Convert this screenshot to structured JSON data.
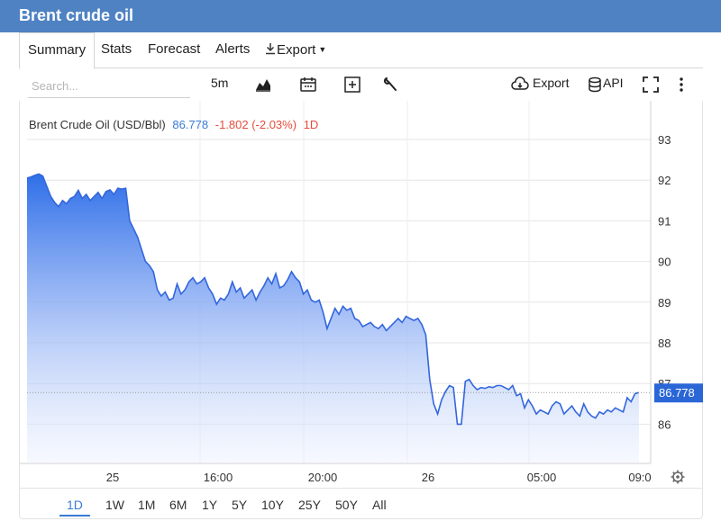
{
  "header": {
    "title": "Brent crude oil"
  },
  "tabs": [
    {
      "label": "Summary",
      "active": true
    },
    {
      "label": "Stats"
    },
    {
      "label": "Forecast"
    },
    {
      "label": "Alerts"
    },
    {
      "label": "Export"
    }
  ],
  "toolbar": {
    "search_placeholder": "Search...",
    "interval": "5m",
    "export_label": "Export",
    "api_label": "API"
  },
  "instrument": {
    "name": "Brent Crude Oil (USD/Bbl)",
    "price": "86.778",
    "change": "-1.802 (-2.03%)",
    "period": "1D",
    "price_color": "#3a7bd5",
    "change_color": "#e74c3c"
  },
  "ranges": [
    "1D",
    "1W",
    "1M",
    "6M",
    "1Y",
    "5Y",
    "10Y",
    "25Y",
    "50Y",
    "All"
  ],
  "active_range": "1D",
  "chart_data": {
    "type": "area",
    "ylim": [
      85.0,
      93.6
    ],
    "y_ticks": [
      86,
      87,
      88,
      89,
      90,
      91,
      92,
      93
    ],
    "x_ticks": [
      "25",
      "16:00",
      "20:00",
      "26",
      "05:00",
      "09:0"
    ],
    "last_value": 86.778,
    "last_value_label": "86.778",
    "line_color": "#3366dd",
    "series": [
      {
        "values": [
          92.05,
          92.08,
          92.12,
          92.15,
          92.1,
          91.85,
          91.6,
          91.45,
          91.35,
          91.5,
          91.42,
          91.55,
          91.6,
          91.75,
          91.55,
          91.65,
          91.5,
          91.6,
          91.7,
          91.55,
          91.72,
          91.76,
          91.65,
          91.8,
          91.78,
          91.8,
          91.0,
          90.8,
          90.6,
          90.3,
          90.0,
          89.9,
          89.75,
          89.3,
          89.15,
          89.25,
          89.05,
          89.1,
          89.45,
          89.2,
          89.3,
          89.5,
          89.6,
          89.45,
          89.5,
          89.6,
          89.35,
          89.2,
          88.95,
          89.1,
          89.05,
          89.2,
          89.5,
          89.25,
          89.35,
          89.1,
          89.2,
          89.3,
          89.05,
          89.25,
          89.4,
          89.6,
          89.45,
          89.7,
          89.35,
          89.4,
          89.55,
          89.75,
          89.6,
          89.5,
          89.2,
          89.3,
          89.05,
          89.0,
          89.05,
          88.75,
          88.35,
          88.6,
          88.85,
          88.7,
          88.9,
          88.8,
          88.85,
          88.6,
          88.55,
          88.4,
          88.45,
          88.5,
          88.4,
          88.35,
          88.45,
          88.3,
          88.4,
          88.5,
          88.6,
          88.5,
          88.65,
          88.6,
          88.55,
          88.6,
          88.45,
          88.2,
          87.1,
          86.5,
          86.25,
          86.6,
          86.8,
          86.95,
          86.9,
          86.0,
          86.0,
          87.05,
          87.1,
          86.95,
          86.85,
          86.9,
          86.88,
          86.92,
          86.9,
          86.95,
          86.95,
          86.9,
          86.85,
          86.95,
          86.7,
          86.75,
          86.4,
          86.6,
          86.45,
          86.25,
          86.35,
          86.3,
          86.25,
          86.45,
          86.55,
          86.5,
          86.25,
          86.35,
          86.45,
          86.3,
          86.2,
          86.5,
          86.3,
          86.2,
          86.15,
          86.3,
          86.25,
          86.35,
          86.3,
          86.4,
          86.35,
          86.3,
          86.65,
          86.55,
          86.75,
          86.778
        ]
      }
    ]
  }
}
